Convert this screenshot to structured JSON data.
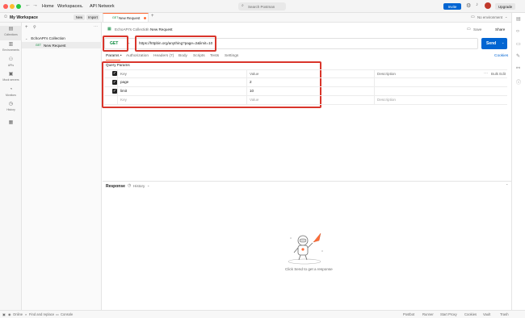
{
  "topbar": {
    "nav": [
      "Home",
      "Workspaces",
      "API Network"
    ],
    "search_placeholder": "Search Postman",
    "invite": "Invite",
    "upgrade": "Upgrade"
  },
  "bar2": {
    "workspace": "My Workspace",
    "new": "New",
    "import": "Import",
    "tab_method": "GET",
    "tab_title": "New Request",
    "environment": "No environment"
  },
  "rail": [
    {
      "name": "collections",
      "label": "Collections",
      "icon": "▤"
    },
    {
      "name": "environments",
      "label": "Environments",
      "icon": "▥"
    },
    {
      "name": "apis",
      "label": "APIs",
      "icon": "⚇"
    },
    {
      "name": "mock-servers",
      "label": "Mock servers",
      "icon": "▣"
    },
    {
      "name": "monitors",
      "label": "Monitors",
      "icon": "◔"
    },
    {
      "name": "history",
      "label": "History",
      "icon": "◷"
    },
    {
      "name": "more",
      "label": "",
      "icon": "▦"
    }
  ],
  "tree": {
    "collection": "EchoAPI's Collection",
    "request_method": "GET",
    "request": "New Request"
  },
  "request": {
    "breadcrumb_collection": "EchoAPI's Collection",
    "breadcrumb_sep": "/",
    "title": "New Request",
    "save": "Save",
    "share": "Share",
    "method": "GET",
    "url": "https://httpbin.org/anything?page=2&limit=10",
    "send": "Send",
    "cookies": "Cookies",
    "tabs": [
      "Params •",
      "Authorization",
      "Headers (7)",
      "Body",
      "Scripts",
      "Tests",
      "Settings"
    ]
  },
  "params": {
    "section": "Query Params",
    "headers": {
      "key": "Key",
      "value": "Value",
      "description": "Description",
      "bulk": "Bulk Edit"
    },
    "rows": [
      {
        "key": "page",
        "value": "2"
      },
      {
        "key": "limit",
        "value": "10"
      }
    ],
    "placeholder": {
      "key": "Key",
      "value": "Value",
      "description": "Description"
    }
  },
  "response": {
    "label": "Response",
    "history": "History",
    "empty": "Click Send to get a response"
  },
  "status": {
    "left": [
      "Online",
      "Find and replace",
      "Console"
    ],
    "right": [
      "Postbot",
      "Runner",
      "Start Proxy",
      "Cookies",
      "Vault",
      "Trash"
    ]
  },
  "colors": {
    "send": "#0265d2",
    "accent": "#ff6c37",
    "highlight": "#d9352b"
  }
}
